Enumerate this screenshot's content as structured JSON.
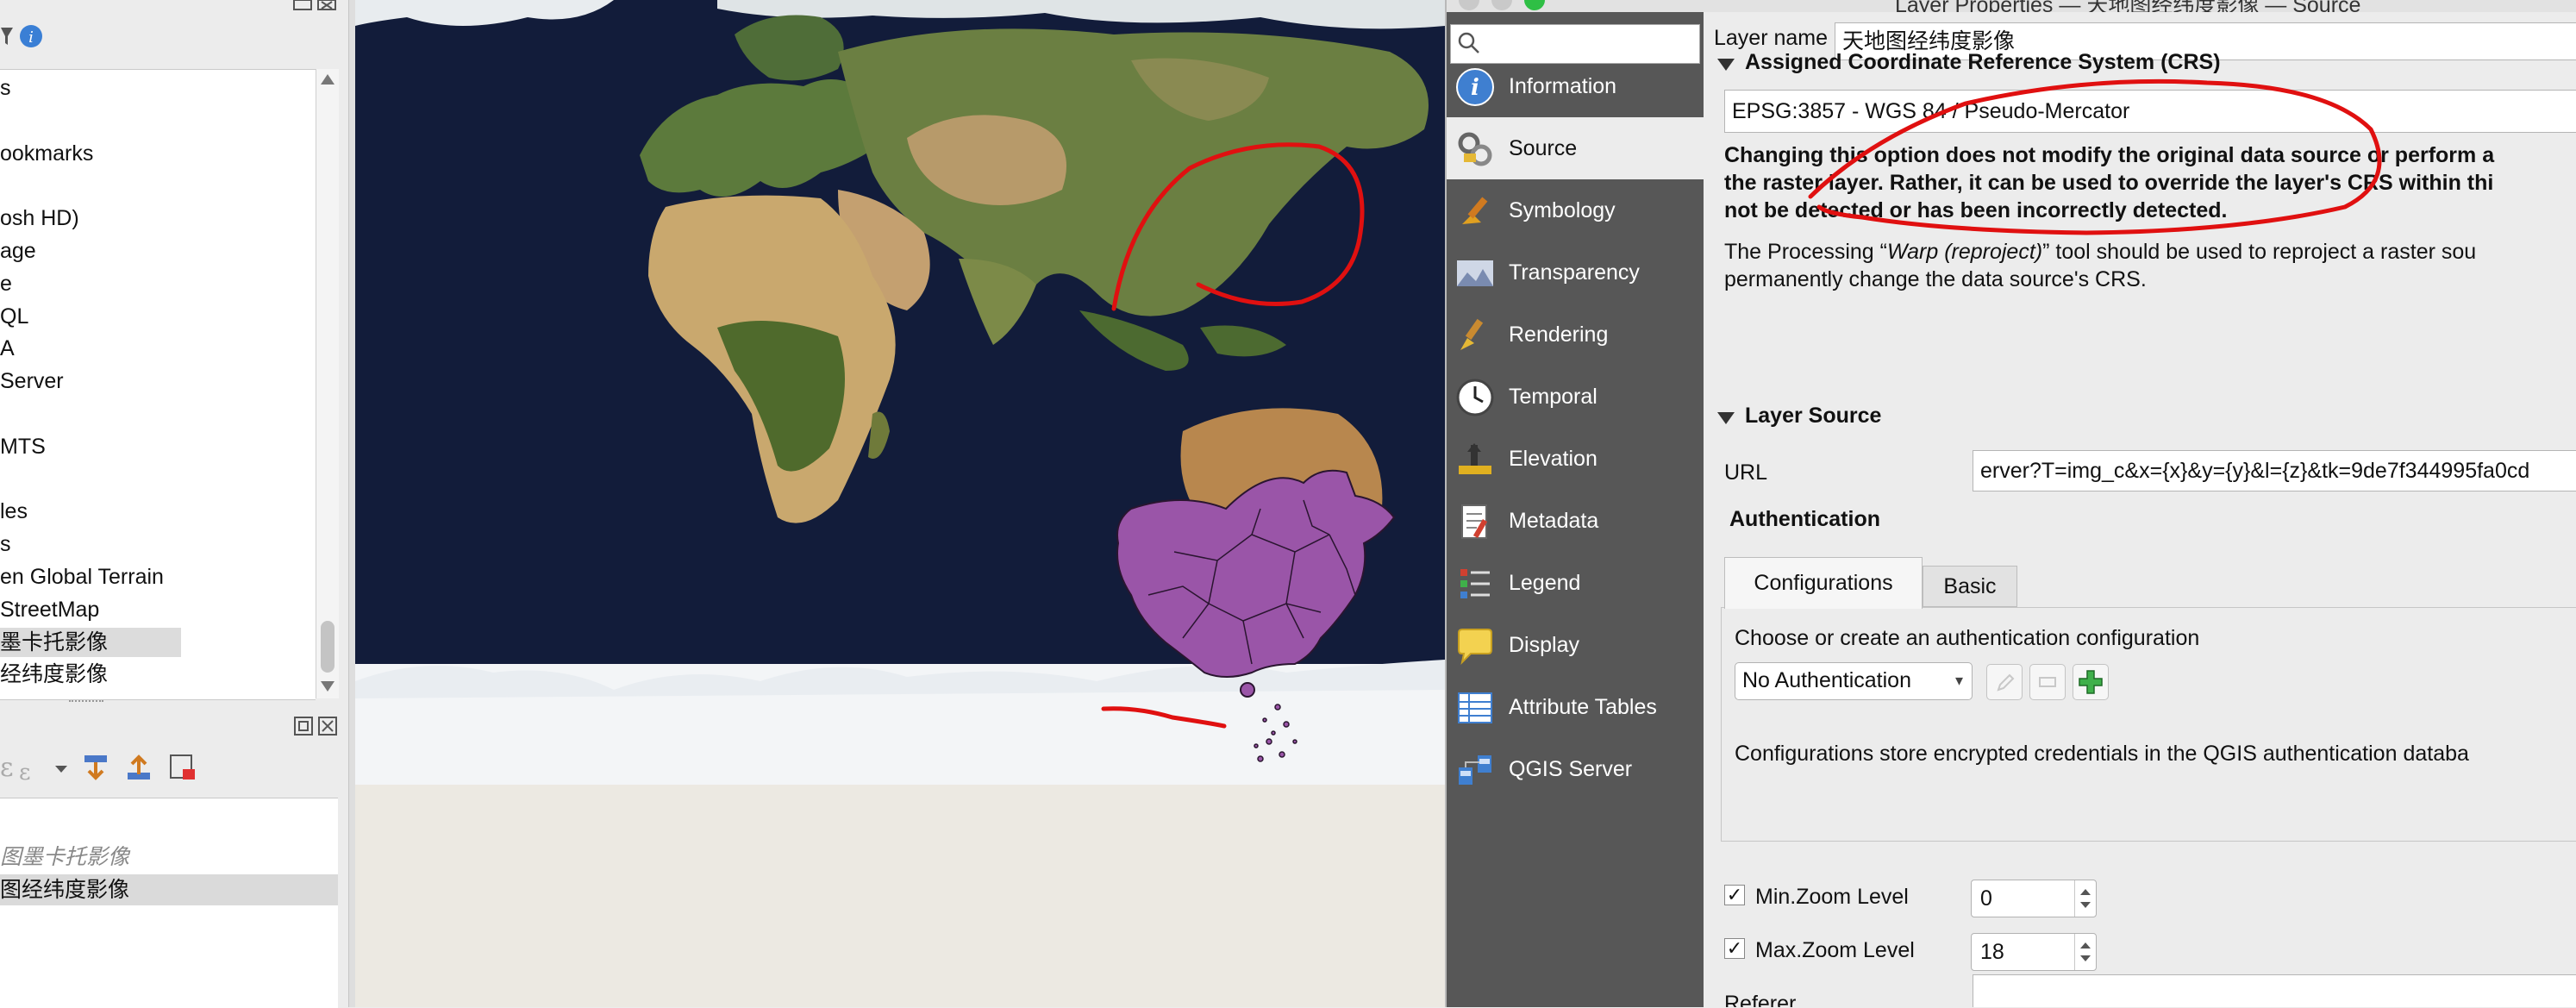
{
  "browser_panel": {
    "items": [
      "s",
      "",
      "ookmarks",
      "",
      "osh HD)",
      "age",
      "e",
      "QL",
      "A",
      "Server",
      "",
      "MTS",
      "",
      "les",
      "s",
      "en Global Terrain",
      "StreetMap",
      "墨卡托影像",
      "经纬度影像"
    ],
    "selected_index": 17
  },
  "layers_panel": {
    "items": [
      {
        "label": "图墨卡托影像",
        "style": "grey"
      },
      {
        "label": "图经纬度影像",
        "style": "selected"
      }
    ]
  },
  "dialog": {
    "title": "Layer Properties — 天地图经纬度影像 — Source",
    "search_placeholder": "",
    "sidebar": [
      {
        "label": "Information",
        "icon": "info-icon"
      },
      {
        "label": "Source",
        "icon": "source-icon"
      },
      {
        "label": "Symbology",
        "icon": "symbology-icon"
      },
      {
        "label": "Transparency",
        "icon": "transparency-icon"
      },
      {
        "label": "Rendering",
        "icon": "rendering-icon"
      },
      {
        "label": "Temporal",
        "icon": "clock-icon"
      },
      {
        "label": "Elevation",
        "icon": "elevation-icon"
      },
      {
        "label": "Metadata",
        "icon": "metadata-icon"
      },
      {
        "label": "Legend",
        "icon": "legend-icon"
      },
      {
        "label": "Display",
        "icon": "speech-bubble-icon"
      },
      {
        "label": "Attribute Tables",
        "icon": "table-icon"
      },
      {
        "label": "QGIS Server",
        "icon": "server-icon"
      }
    ],
    "active_index": 1,
    "layer_name_label": "Layer name",
    "layer_name_value": "天地图经纬度影像",
    "crs_section": "Assigned Coordinate Reference System (CRS)",
    "crs_value": "EPSG:3857 - WGS 84 / Pseudo-Mercator",
    "crs_warning": [
      "Changing this option does not modify the original data source or perform a",
      "the raster layer. Rather, it can be used to override the layer's CRS within thi",
      "not be detected or has been incorrectly detected."
    ],
    "crs_note_prefix": "The Processing “",
    "crs_note_tool": "Warp (reproject)",
    "crs_note_suffix": "” tool should be used to reproject a raster sou",
    "crs_note_line2": "permanently change the data source's CRS.",
    "layer_source_section": "Layer Source",
    "url_label": "URL",
    "url_value": "erver?T=img_c&x={x}&y={y}&l={z}&tk=9de7f344995fa0cd",
    "authentication_label": "Authentication",
    "tabs": [
      "Configurations",
      "Basic"
    ],
    "auth_prompt": "Choose or create an authentication configuration",
    "auth_combo": "No Authentication",
    "auth_info": "Configurations store encrypted credentials in the QGIS authentication databa",
    "min_zoom_label": "Min.Zoom Level",
    "min_zoom_value": "0",
    "max_zoom_label": "Max.Zoom Level",
    "max_zoom_value": "18",
    "referer_label": "Referer",
    "min_zoom_checked": true,
    "max_zoom_checked": true
  },
  "colors": {
    "sidebar_bg": "#575757",
    "annotation_red": "#e01010",
    "china_fill": "#9a55a8",
    "ocean": "#121c3a"
  }
}
